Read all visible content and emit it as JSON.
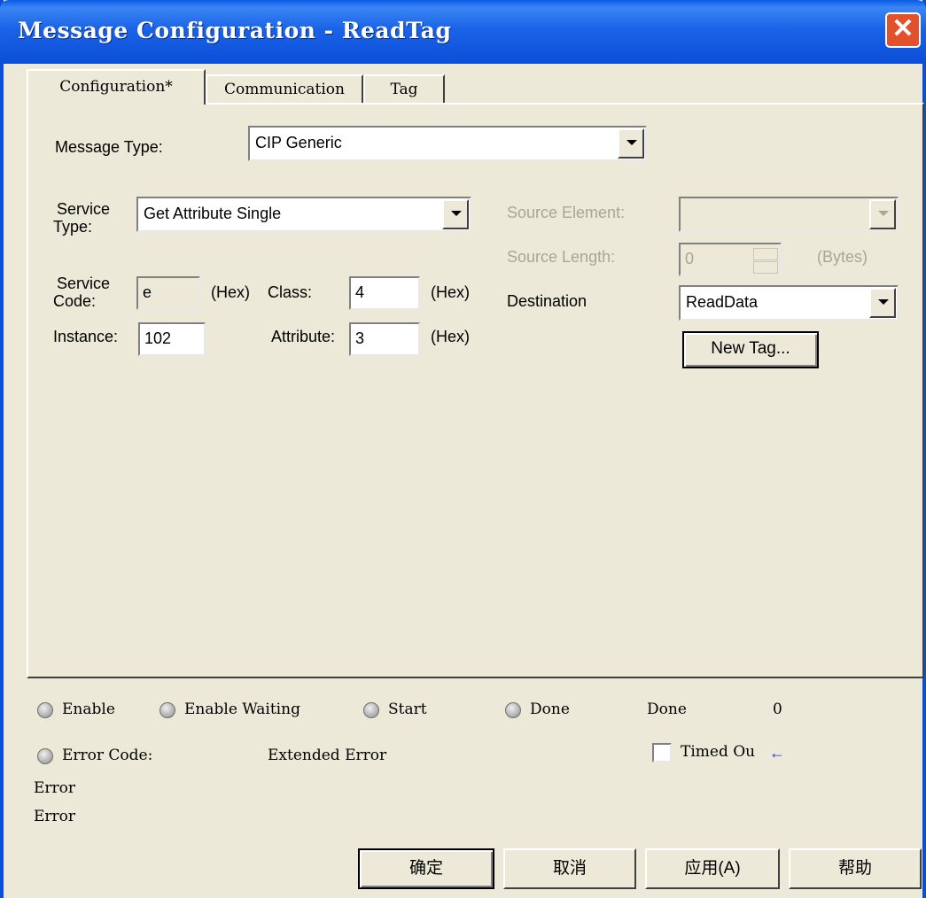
{
  "window": {
    "title": "Message Configuration - ReadTag",
    "close_label": "✕"
  },
  "tabs": [
    "Configuration*",
    "Communication",
    "Tag"
  ],
  "form": {
    "message_type_label": "Message Type:",
    "message_type_value": "CIP Generic",
    "service_type_label_1": "Service",
    "service_type_label_2": "Type:",
    "service_type_value": "Get Attribute Single",
    "service_code_label_1": "Service",
    "service_code_label_2": "Code:",
    "service_code_value": "e",
    "hex1": "(Hex)",
    "class_label": "Class:",
    "class_value": "4",
    "hex2": "(Hex)",
    "instance_label": "Instance:",
    "instance_value": "102",
    "attribute_label": "Attribute:",
    "attribute_value": "3",
    "hex3": "(Hex)",
    "source_element_label": "Source Element:",
    "source_element_value": "",
    "source_length_label": "Source Length:",
    "source_length_value": "0",
    "bytes_label": "(Bytes)",
    "destination_label": "Destination",
    "destination_value": "ReadData",
    "new_tag_label": "New Tag..."
  },
  "status": {
    "enable": "Enable",
    "enable_waiting": "Enable Waiting",
    "start": "Start",
    "done": "Done",
    "done_length_label": "Done",
    "done_length_value": "0",
    "error_code": "Error Code:",
    "extended_error": "Extended Error",
    "timed_out": "Timed Ou",
    "error_line_1": "Error",
    "error_line_2": "Error"
  },
  "buttons": {
    "ok": "确定",
    "cancel": "取消",
    "apply": "应用(A)",
    "help": "帮助"
  },
  "colors": {
    "titlebar": "#0b4fd6",
    "dialog_bg": "#ece9d8",
    "close_button": "#e0512c"
  }
}
